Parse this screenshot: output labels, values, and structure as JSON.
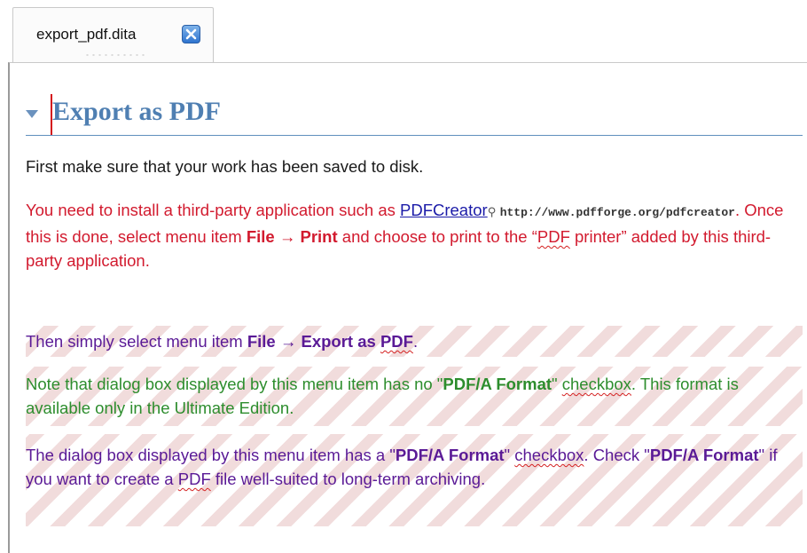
{
  "tab": {
    "title": "export_pdf.dita"
  },
  "doc": {
    "title": "Export as PDF",
    "p1": "First make sure that your work has been saved to disk.",
    "p2": {
      "before_link": "You need to install a third-party application such as ",
      "link_text": "PDFCreator",
      "link_url": "http://www.pdfforge.org/pdfcreator",
      "after_link": ". Once this is done, select menu item ",
      "menu_file": "File",
      "arrow": " → ",
      "menu_print": "Print",
      "middle": " and choose to print to the “",
      "pdf": "PDF",
      "end": " printer” added by this third-party application."
    },
    "p3": {
      "before": "Then simply select menu item ",
      "menu_file": "File",
      "arrow": " → ",
      "menu_export_pre": "Export as ",
      "menu_export_pdf": "PDF",
      "end": "."
    },
    "p4": {
      "before": "Note that dialog box displayed by this menu item has no \"",
      "format": "PDF/A Format",
      "mid": "\" ",
      "checkbox": "checkbox",
      "end": ". This format is available only in the Ultimate Edition."
    },
    "p5": {
      "before": "The dialog box displayed by this menu item has a \"",
      "format": "PDF/A Format",
      "mid": "\" ",
      "checkbox": "checkbox",
      "mid2": ". Check \"",
      "format2": "PDF/A Format",
      "mid3": "\" if you want to create a ",
      "pdf": "PDF",
      "end": " file well-suited to long-term archiving."
    }
  },
  "colors": {
    "title": "#4f7fb2",
    "conditional_red": "#d21a2e",
    "conditional_purple": "#5a1a96",
    "conditional_green": "#2d8d2d",
    "hatch": "#f1dcdc"
  },
  "icons": {
    "tab_close": "close-icon",
    "collapse": "triangle-down-icon",
    "external_link": "link-icon"
  }
}
